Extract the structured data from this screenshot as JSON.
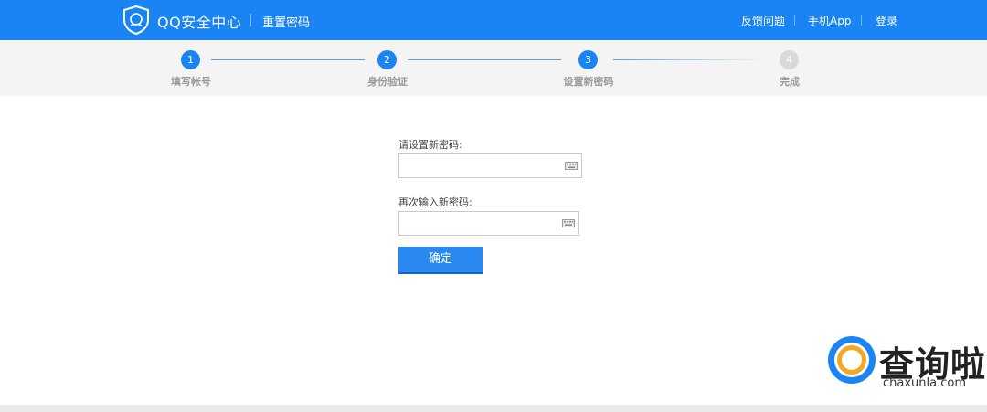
{
  "header": {
    "brand": "QQ安全中心",
    "page_name": "重置密码",
    "nav": [
      "反馈问题",
      "手机App",
      "登录"
    ]
  },
  "steps": [
    {
      "num": "1",
      "label": "填写帐号",
      "active": true
    },
    {
      "num": "2",
      "label": "身份验证",
      "active": true
    },
    {
      "num": "3",
      "label": "设置新密码",
      "active": true
    },
    {
      "num": "4",
      "label": "完成",
      "active": false
    }
  ],
  "form": {
    "new_password_label": "请设置新密码:",
    "new_password_value": "",
    "confirm_password_label": "再次输入新密码:",
    "confirm_password_value": "",
    "submit_label": "确定"
  },
  "watermark": {
    "text": "查询啦",
    "sub": "chaxunla.com"
  },
  "colors": {
    "primary": "#1a84f5",
    "step_inactive": "#d9d9d9",
    "steps_bg": "#f4f4f4"
  }
}
